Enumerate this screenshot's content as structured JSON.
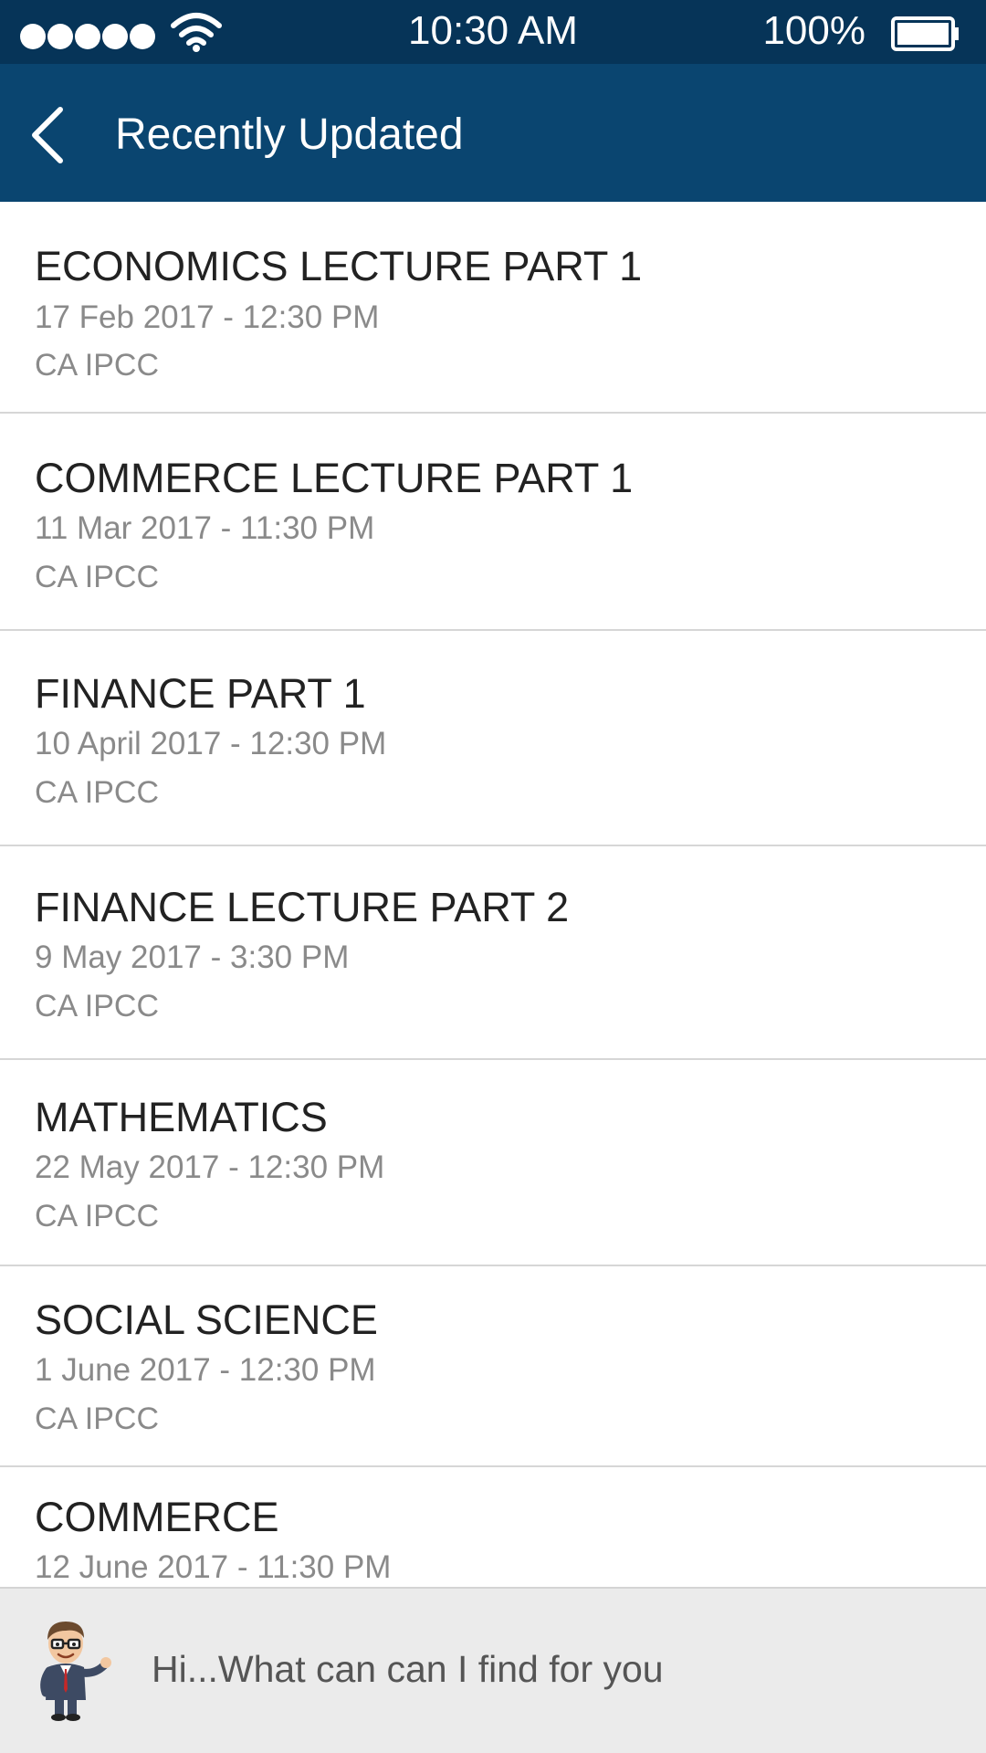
{
  "status_bar": {
    "time": "10:30 AM",
    "battery_percent": "100%",
    "signal_icon": "signal-dots-icon",
    "wifi_icon": "wifi-icon",
    "battery_icon": "battery-icon",
    "battery_level": 1.0
  },
  "header": {
    "title": "Recently Updated",
    "back_icon": "chevron-left-icon",
    "background_color": "#0a4570",
    "status_color": "#063458"
  },
  "items": [
    {
      "title": "ECONOMICS LECTURE PART 1",
      "date": "17 Feb 2017 - 12:30 PM",
      "category": "CA IPCC"
    },
    {
      "title": "COMMERCE LECTURE PART 1",
      "date": "11 Mar 2017 - 11:30 PM",
      "category": "CA IPCC"
    },
    {
      "title": "FINANCE PART 1",
      "date": "10 April 2017 - 12:30 PM",
      "category": "CA IPCC"
    },
    {
      "title": "FINANCE LECTURE PART 2",
      "date": "9 May 2017 - 3:30 PM",
      "category": "CA IPCC"
    },
    {
      "title": "MATHEMATICS",
      "date": "22 May 2017 - 12:30 PM",
      "category": "CA IPCC"
    },
    {
      "title": "SOCIAL SCIENCE",
      "date": "1 June 2017 - 12:30 PM",
      "category": "CA IPCC"
    },
    {
      "title": "COMMERCE",
      "date": "12 June 2017 - 11:30 PM",
      "category": ""
    }
  ],
  "assistant": {
    "prompt": "Hi...What can can I find for you",
    "avatar_icon": "assistant-avatar-icon"
  }
}
